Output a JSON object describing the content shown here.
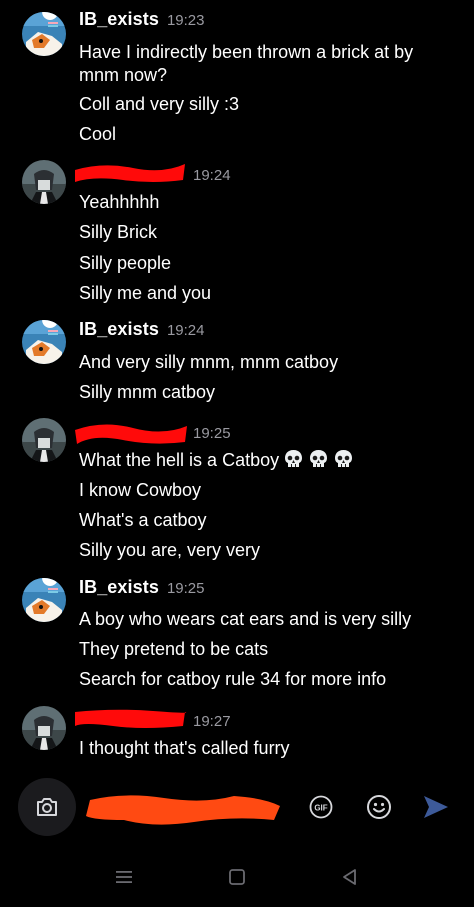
{
  "colors": {
    "background": "#000000",
    "text": "#ffffff",
    "timestamp": "#9a9aa1",
    "redaction_red": "#ff0a0a",
    "redaction_orange": "#ff4a12",
    "send_blue": "#3d5a99"
  },
  "messages": [
    {
      "sender": "IB_exists",
      "time": "19:23",
      "avatar": "ib-exists-avatar",
      "lines": [
        "Have I indirectly been thrown a brick at by",
        "mnm now?",
        "Coll and very silly :3",
        "Cool"
      ]
    },
    {
      "sender": "",
      "time": "19:24",
      "avatar": "other-user-avatar",
      "lines": [
        "Yeahhhhh",
        "Silly Brick",
        "Silly people",
        "Silly me and you"
      ]
    },
    {
      "sender": "IB_exists",
      "time": "19:24",
      "avatar": "ib-exists-avatar",
      "lines": [
        "And very silly mnm, mnm catboy",
        "Silly mnm catboy"
      ]
    },
    {
      "sender": "",
      "time": "19:25",
      "avatar": "other-user-avatar",
      "lines": [
        "What the hell is a Catboy",
        "I know Cowboy",
        "What's a catboy",
        "Silly you are, very very"
      ],
      "line0_emoji": [
        "skull-icon",
        "skull-icon",
        "skull-icon"
      ]
    },
    {
      "sender": "IB_exists",
      "time": "19:25",
      "avatar": "ib-exists-avatar",
      "lines": [
        "A boy who wears cat ears and is very silly",
        "They pretend to be cats",
        "Search for catboy rule 34 for more info"
      ]
    },
    {
      "sender": "",
      "time": "19:27",
      "avatar": "other-user-avatar",
      "lines": [
        "I thought that's called furry"
      ]
    }
  ],
  "input_bar": {
    "camera_icon": "camera-icon",
    "text": "",
    "gif_icon": "gif-icon",
    "gif_label": "GIF",
    "emoji_icon": "smiley-icon",
    "send_icon": "send-icon"
  },
  "system_nav": {
    "recents_icon": "menu-icon",
    "home_icon": "square-icon",
    "back_icon": "back-triangle-icon"
  }
}
